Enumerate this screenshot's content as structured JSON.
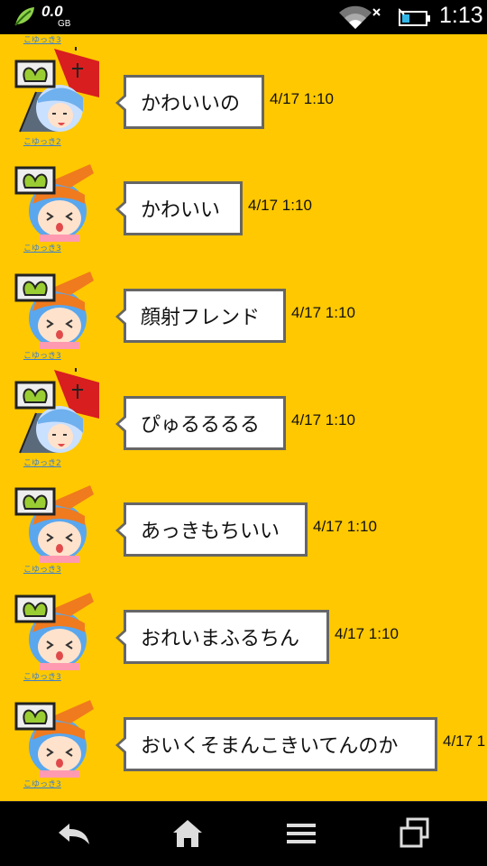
{
  "status_bar": {
    "data_value": "0.0",
    "data_unit": "GB",
    "time": "1:13",
    "icons": [
      "leaf-icon",
      "wifi-icon",
      "battery-icon"
    ]
  },
  "chat": {
    "top_partial_label": "こゆっき3",
    "messages": [
      {
        "user": "こゆっき2",
        "avatar": "umbrella-girl-avatar",
        "text": "かわいいの",
        "time": "4/17 1:10"
      },
      {
        "user": "こゆっき3",
        "avatar": "blue-hair-girl-avatar",
        "text": "かわいい",
        "time": "4/17 1:10"
      },
      {
        "user": "こゆっき3",
        "avatar": "blue-hair-girl-avatar",
        "text": "顔射フレンド",
        "time": "4/17 1:10"
      },
      {
        "user": "こゆっき2",
        "avatar": "umbrella-girl-avatar",
        "text": "ぴゅるるるる",
        "time": "4/17 1:10"
      },
      {
        "user": "こゆっき3",
        "avatar": "blue-hair-girl-avatar",
        "text": "あっきもちいい",
        "time": "4/17 1:10"
      },
      {
        "user": "こゆっき3",
        "avatar": "blue-hair-girl-avatar",
        "text": "おれいまふるちん",
        "time": "4/17 1:10"
      },
      {
        "user": "こゆっき3",
        "avatar": "blue-hair-girl-avatar",
        "text": "おいくそまんこきいてんのか",
        "time": "4/17 1"
      }
    ]
  },
  "nav_bar": {
    "buttons": [
      "back",
      "home",
      "menu",
      "recent-apps"
    ]
  },
  "colors": {
    "background": "#FFC800",
    "bubble_border": "#666666",
    "username_link": "#3B7FD0"
  }
}
